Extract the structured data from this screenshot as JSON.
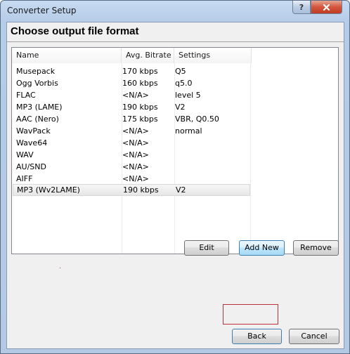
{
  "window": {
    "title": "Converter Setup",
    "help_label": "?",
    "close_icon": "close-icon"
  },
  "heading": "Choose output file format",
  "list": {
    "columns": [
      "Name",
      "Avg. Bitrate",
      "Settings"
    ],
    "rows": [
      [
        "Musepack",
        "170 kbps",
        "Q5"
      ],
      [
        "Ogg Vorbis",
        "160 kbps",
        "q5.0"
      ],
      [
        "FLAC",
        "<N/A>",
        "level 5"
      ],
      [
        "MP3 (LAME)",
        "190 kbps",
        "V2"
      ],
      [
        "AAC (Nero)",
        "175 kbps",
        "VBR, Q0.50"
      ],
      [
        "WavPack",
        "<N/A>",
        "normal"
      ],
      [
        "Wave64",
        "<N/A>",
        ""
      ],
      [
        "WAV",
        "<N/A>",
        ""
      ],
      [
        "AU/SND",
        "<N/A>",
        ""
      ],
      [
        "AIFF",
        "<N/A>",
        ""
      ],
      [
        "MP3 (Wv2LAME)",
        "190 kbps",
        "V2"
      ]
    ],
    "selected_index": 10
  },
  "buttons": {
    "edit": "Edit",
    "add_new": "Add New",
    "remove": "Remove",
    "back": "Back",
    "cancel": "Cancel"
  },
  "colors": {
    "accent": "#3c7fb1",
    "highlight_box": "#c0303a",
    "close": "#c13a22"
  }
}
